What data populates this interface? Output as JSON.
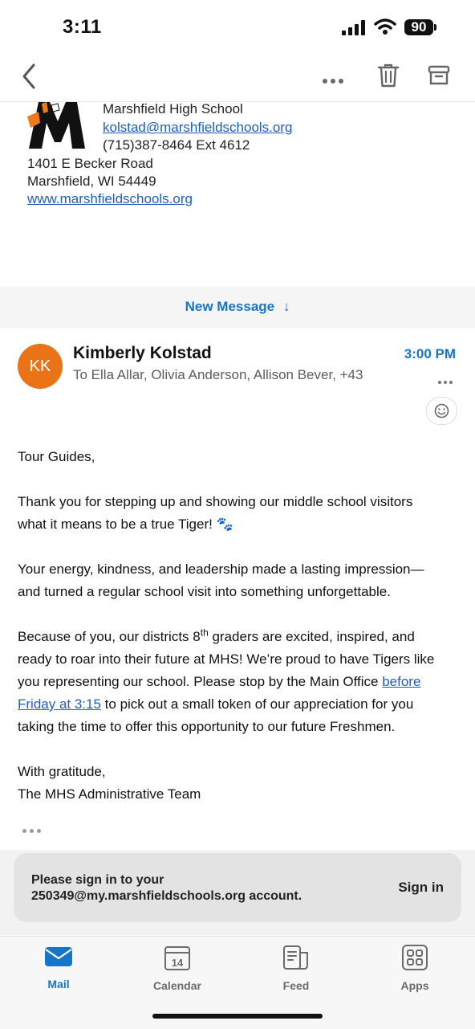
{
  "status_bar": {
    "time": "3:11",
    "battery": "90"
  },
  "toolbar": {
    "back": "back",
    "more": "more",
    "delete": "delete",
    "archive": "archive"
  },
  "signature": {
    "school": "Marshfield High School",
    "email": "kolstad@marshfieldschools.org",
    "phone": "(715)387-8464  Ext 4612",
    "address1": "1401 E Becker Road",
    "address2": "Marshfield, WI  54449",
    "website": "www.marshfieldschools.org"
  },
  "new_message": {
    "label": "New Message",
    "arrow": "↓"
  },
  "message": {
    "avatar_initials": "KK",
    "sender": "Kimberly Kolstad",
    "time": "3:00 PM",
    "recipients": "To Ella Allar, Olivia Anderson, Allison Bever, +43",
    "greeting": "Tour Guides,",
    "para1_line1": "Thank you for stepping up and showing our middle school visitors",
    "para1_line2": "what it means to be a true Tiger! 🐾",
    "para2_line1": "Your energy, kindness, and leadership made a lasting impression—",
    "para2_line2": "and turned a regular school visit into something unforgettable.",
    "para3_a": "Because of you, our districts 8",
    "para3_sup": "th",
    "para3_b": " graders are excited, inspired, and",
    "para3_line2": "ready to roar into their future at MHS!  We’re proud to have Tigers like",
    "para3_line3a": "you representing our school.  Please stop by the Main Office ",
    "para3_link1": "before ",
    "para3_link2": "Friday at 3:15",
    "para3_line4b": " to pick out a small token of our appreciation for you",
    "para3_line5": "taking the time to offer this opportunity to our future Freshmen.",
    "closing": "With gratitude,",
    "signoff": "The MHS Administrative Team"
  },
  "signin_card": {
    "line1": "Please sign in to your",
    "line2": "250349@my.marshfieldschools.org account.",
    "button": "Sign in"
  },
  "tabs": [
    {
      "label": "Mail",
      "icon": "mail-icon",
      "active": true
    },
    {
      "label": "Calendar",
      "icon": "calendar-icon",
      "badge": "14"
    },
    {
      "label": "Feed",
      "icon": "feed-icon"
    },
    {
      "label": "Apps",
      "icon": "apps-icon"
    }
  ],
  "colors": {
    "accent": "#1575c9",
    "avatar": "#e97316",
    "link": "#1f5fb8"
  }
}
